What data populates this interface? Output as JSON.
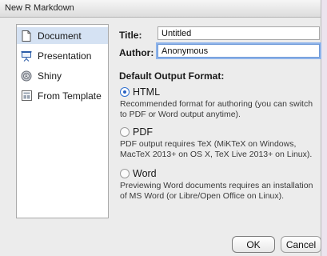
{
  "window": {
    "title": "New R Markdown"
  },
  "sidebar": {
    "items": [
      {
        "label": "Document",
        "icon": "document-icon",
        "selected": true
      },
      {
        "label": "Presentation",
        "icon": "presentation-icon",
        "selected": false
      },
      {
        "label": "Shiny",
        "icon": "shiny-icon",
        "selected": false
      },
      {
        "label": "From Template",
        "icon": "template-icon",
        "selected": false
      }
    ]
  },
  "form": {
    "title_label": "Title:",
    "title_value": "Untitled",
    "author_label": "Author:",
    "author_value": "Anonymous"
  },
  "output": {
    "heading": "Default Output Format:",
    "options": [
      {
        "label": "HTML",
        "selected": true,
        "description": "Recommended format for authoring (you can switch to PDF or Word output anytime)."
      },
      {
        "label": "PDF",
        "selected": false,
        "description": "PDF output requires TeX (MiKTeX on Windows, MacTeX 2013+ on OS X, TeX Live 2013+ on Linux)."
      },
      {
        "label": "Word",
        "selected": false,
        "description": "Previewing Word documents requires an installation of MS Word (or Libre/Open Office on Linux)."
      }
    ]
  },
  "buttons": {
    "ok": "OK",
    "cancel": "Cancel"
  },
  "colors": {
    "selection": "#d5e2f3",
    "focus_ring": "#8fb4ea",
    "radio_accent": "#2a62c4"
  }
}
